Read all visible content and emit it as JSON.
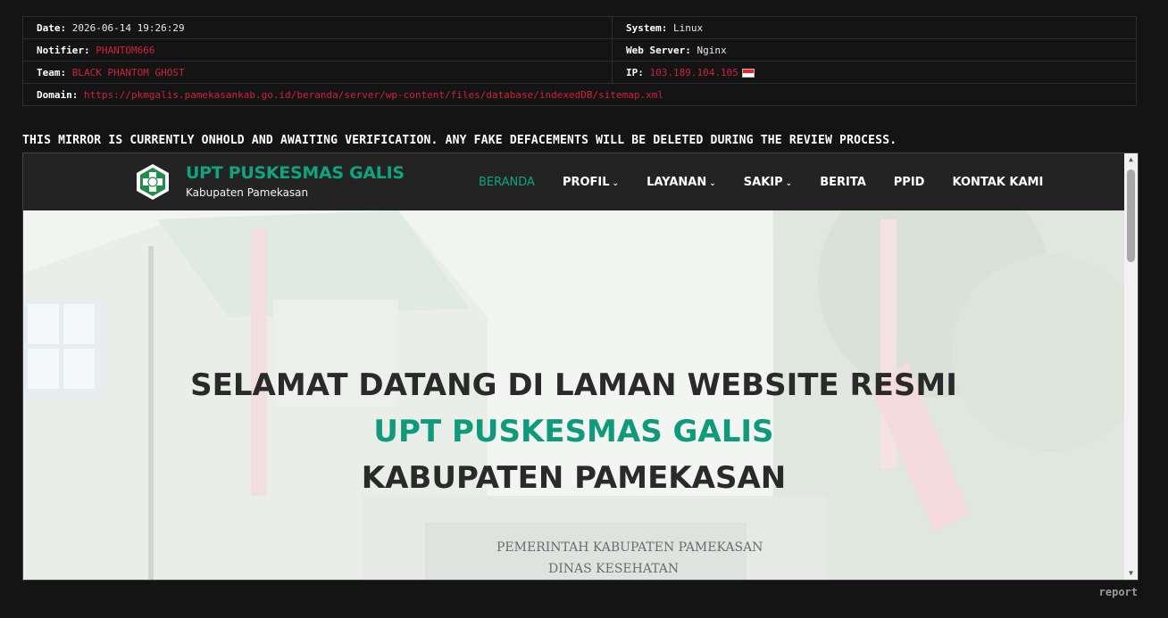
{
  "info": {
    "date_label": "Date:",
    "date_value": "2026-06-14 19:26:29",
    "system_label": "System:",
    "system_value": "Linux",
    "notifier_label": "Notifier:",
    "notifier_value": "PHANTOM666",
    "webserver_label": "Web Server:",
    "webserver_value": "Nginx",
    "team_label": "Team:",
    "team_value": "BLACK PHANTOM GHOST",
    "ip_label": "IP:",
    "ip_value": "103.189.104.105",
    "domain_label": "Domain:",
    "domain_value": "https://pkmgalis.pamekasankab.go.id/beranda/server/wp-content/files/database/indexedDB/sitemap.xml"
  },
  "notice": "THIS MIRROR IS CURRENTLY ONHOLD AND AWAITING VERIFICATION. ANY FAKE DEFACEMENTS WILL BE DELETED DURING THE REVIEW PROCESS.",
  "site": {
    "brand_title": "UPT PUSKESMAS GALIS",
    "brand_subtitle": "Kabupaten Pamekasan",
    "menu": [
      {
        "label": "BERANDA",
        "active": true,
        "dropdown": false
      },
      {
        "label": "PROFIL",
        "active": false,
        "dropdown": true
      },
      {
        "label": "LAYANAN",
        "active": false,
        "dropdown": true
      },
      {
        "label": "SAKIP",
        "active": false,
        "dropdown": true
      },
      {
        "label": "BERITA",
        "active": false,
        "dropdown": false
      },
      {
        "label": "PPID",
        "active": false,
        "dropdown": false
      },
      {
        "label": "KONTAK KAMI",
        "active": false,
        "dropdown": false
      }
    ],
    "hero_line1": "SELAMAT DATANG DI LAMAN WEBSITE RESMI",
    "hero_line2": "UPT PUSKESMAS GALIS",
    "hero_line3": "KABUPATEN PAMEKASAN",
    "sign_line1": "PEMERINTAH KABUPATEN PAMEKASAN",
    "sign_line2": "DINAS KESEHATAN"
  },
  "caret_glyph": "⌄",
  "report_label": "report",
  "colors": {
    "accent_red": "#d0213c",
    "brand_green": "#0fa382",
    "background": "#141414"
  }
}
